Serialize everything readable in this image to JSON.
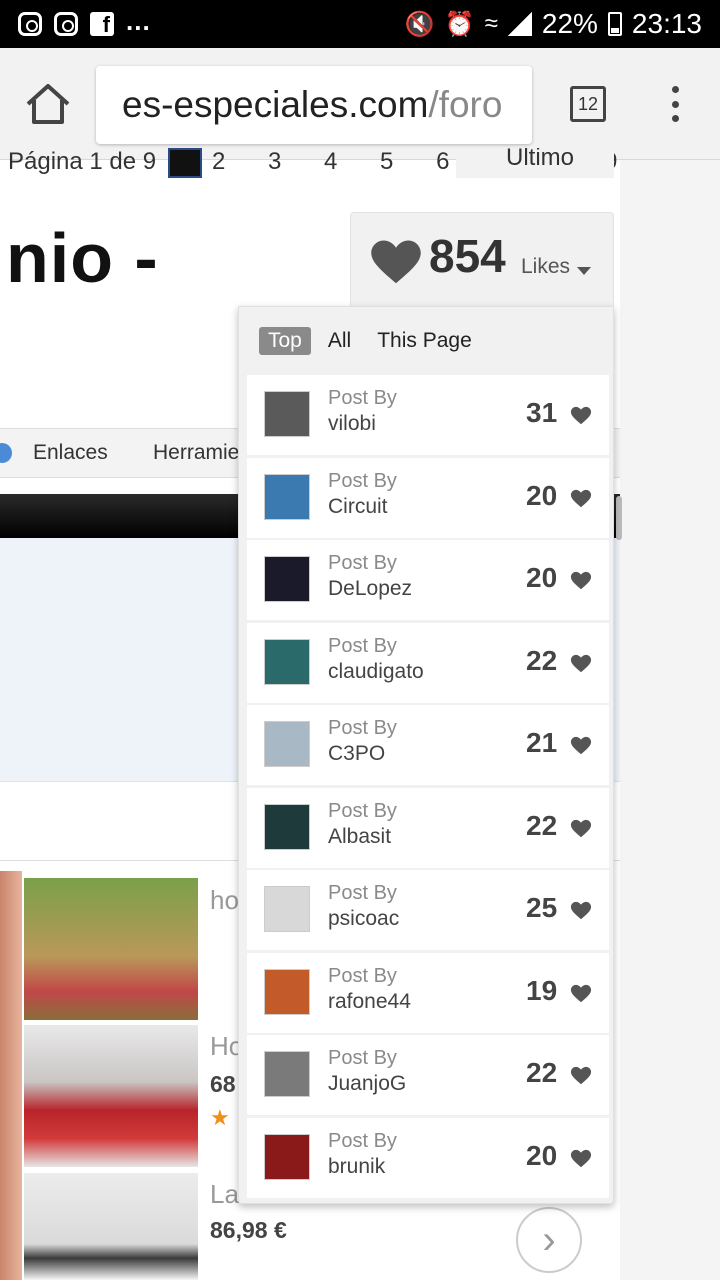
{
  "status": {
    "more": "...",
    "battery": "22%",
    "time": "23:13"
  },
  "browser": {
    "url_domain": "es-especiales.com",
    "url_path": "/foro",
    "tab_count": "12"
  },
  "page": {
    "pager_label": "Página 1 de 9",
    "pager_numbers": "2 3 4 5 6 7 8 9",
    "pager_last": "Último",
    "title_fragment": "nio -",
    "nav_links": [
      "Enlaces",
      "Herramie"
    ]
  },
  "ads": {
    "titles": [
      "ho",
      "Ho",
      "La"
    ],
    "prices": [
      "68",
      "86,98 €"
    ]
  },
  "likes": {
    "total": "854",
    "label": "Likes",
    "tabs": [
      "Top",
      "All",
      "This Page"
    ],
    "post_by_label": "Post By",
    "colors": {
      "heart": "#555555",
      "active_tab": "#8a8a8a"
    },
    "rows": [
      {
        "user": "vilobi",
        "count": "31",
        "avatar": "#5a5a5a"
      },
      {
        "user": "Circuit",
        "count": "20",
        "avatar": "#3a7ab0"
      },
      {
        "user": "DeLopez",
        "count": "20",
        "avatar": "#1a1a2a"
      },
      {
        "user": "claudigato",
        "count": "22",
        "avatar": "#2a6a6a"
      },
      {
        "user": "C3PO",
        "count": "21",
        "avatar": "#a8b8c4"
      },
      {
        "user": "Albasit",
        "count": "22",
        "avatar": "#1e3a3a"
      },
      {
        "user": "psicoac",
        "count": "25",
        "avatar": "#d8d8d8"
      },
      {
        "user": "rafone44",
        "count": "19",
        "avatar": "#c25a2a"
      },
      {
        "user": "JuanjoG",
        "count": "22",
        "avatar": "#7a7a7a"
      },
      {
        "user": "brunik",
        "count": "20",
        "avatar": "#8a1a1a"
      }
    ]
  }
}
